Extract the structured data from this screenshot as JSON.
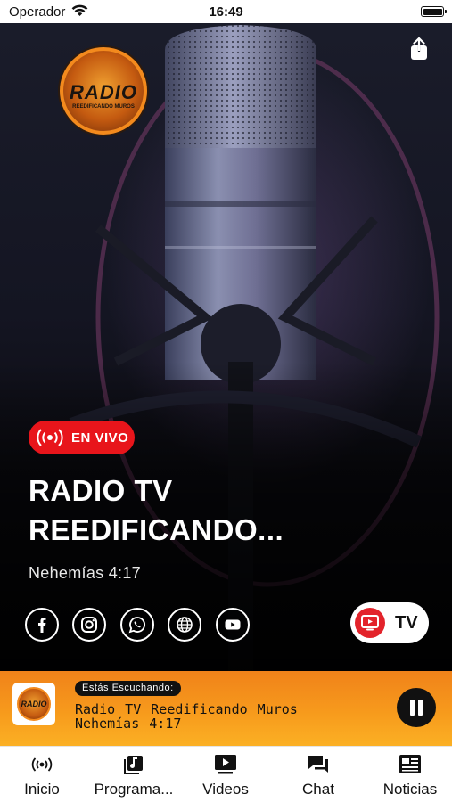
{
  "status_bar": {
    "carrier": "Operador",
    "time": "16:49"
  },
  "hero": {
    "logo_text": "RADIO",
    "logo_subtext": "REEDIFICANDO MUROS",
    "live_badge": "EN VIVO",
    "title_line1": "RADIO TV",
    "title_line2": "REEDIFICANDO...",
    "subtitle": "Nehemías 4:17",
    "social_icons": [
      "facebook-icon",
      "instagram-icon",
      "whatsapp-icon",
      "globe-icon",
      "youtube-icon"
    ],
    "tv_button_label": "TV"
  },
  "now_playing": {
    "label": "Estás Escuchando:",
    "title": "Radio TV Reedificando Muros",
    "subtitle": "Nehemías 4:17",
    "state_icon": "pause-icon"
  },
  "tab_bar": {
    "tabs": [
      {
        "label": "Inicio",
        "icon": "live-icon"
      },
      {
        "label": "Programa...",
        "icon": "music-note-icon"
      },
      {
        "label": "Videos",
        "icon": "video-icon"
      },
      {
        "label": "Chat",
        "icon": "chat-icon"
      },
      {
        "label": "Noticias",
        "icon": "news-icon"
      }
    ]
  },
  "colors": {
    "accent_red": "#e8151b",
    "player_orange": "#f79a1c",
    "dark": "#111111"
  }
}
